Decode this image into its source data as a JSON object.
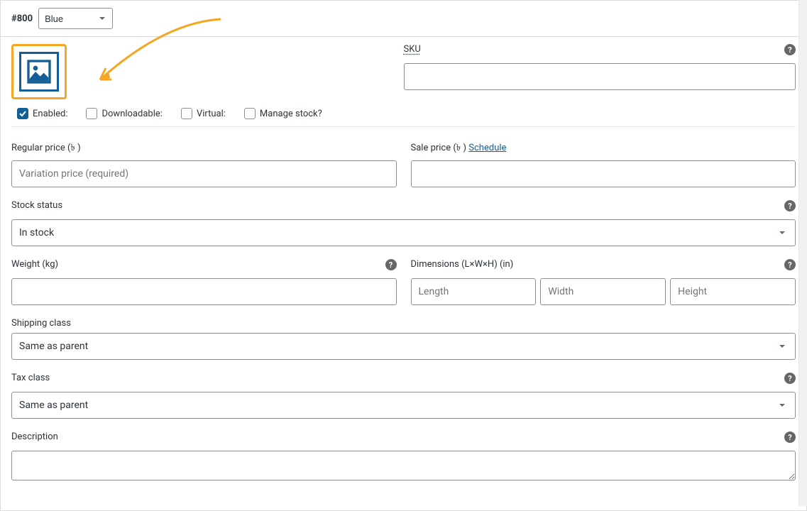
{
  "header": {
    "variation_id": "#800",
    "attribute_value": "Blue"
  },
  "checkboxes": {
    "enabled": {
      "label": "Enabled:",
      "checked": true
    },
    "downloadable": {
      "label": "Downloadable:",
      "checked": false
    },
    "virtual": {
      "label": "Virtual:",
      "checked": false
    },
    "manage_stock": {
      "label": "Manage stock?",
      "checked": false
    }
  },
  "fields": {
    "sku": {
      "label": "SKU",
      "value": ""
    },
    "regular_price": {
      "label": "Regular price (৳ )",
      "placeholder": "Variation price (required)",
      "value": ""
    },
    "sale_price": {
      "label": "Sale price (৳ )",
      "schedule_text": "Schedule",
      "value": ""
    },
    "stock_status": {
      "label": "Stock status",
      "value": "In stock"
    },
    "weight": {
      "label": "Weight (kg)",
      "value": ""
    },
    "dimensions": {
      "label": "Dimensions (L×W×H) (in)",
      "length": {
        "placeholder": "Length",
        "value": ""
      },
      "width": {
        "placeholder": "Width",
        "value": ""
      },
      "height": {
        "placeholder": "Height",
        "value": ""
      }
    },
    "shipping_class": {
      "label": "Shipping class",
      "value": "Same as parent"
    },
    "tax_class": {
      "label": "Tax class",
      "value": "Same as parent"
    },
    "description": {
      "label": "Description",
      "value": ""
    }
  }
}
